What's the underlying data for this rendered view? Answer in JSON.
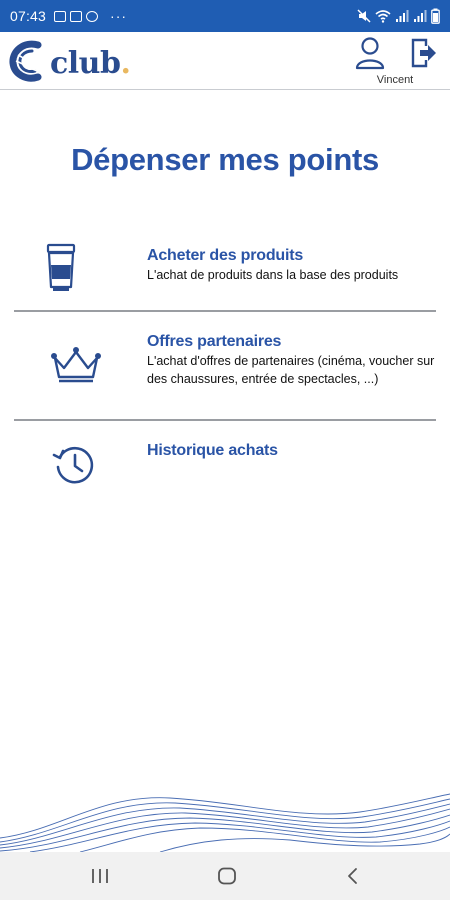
{
  "status_bar": {
    "time": "07:43",
    "more": "···",
    "notification_icons": [
      "gallery-icon",
      "youtube-icon",
      "app-icon"
    ],
    "system_icons": [
      "mute-icon",
      "wifi-icon",
      "signal-icon",
      "signal-icon",
      "battery-icon"
    ]
  },
  "header": {
    "logo_text": "club",
    "logo_dot": ".",
    "user_name": "Vincent",
    "brand_color": "#2a4c8f",
    "accent_color": "#e9b860"
  },
  "page": {
    "title": "Dépenser mes points",
    "title_color": "#2a54a6"
  },
  "menu": {
    "items": [
      {
        "title": "Acheter des produits",
        "description": "L'achat de produits dans la base des produits",
        "icon": "product-tube-icon"
      },
      {
        "title": "Offres partenaires",
        "description": "L'achat d'offres de partenaires (cinéma, voucher sur des chaussures, entrée de spectacles, ...)",
        "icon": "crown-icon"
      },
      {
        "title": "Historique achats",
        "description": "",
        "icon": "history-clock-icon"
      }
    ]
  },
  "nav_bar": {
    "buttons": [
      "recent-apps-icon",
      "home-icon",
      "back-icon"
    ]
  }
}
